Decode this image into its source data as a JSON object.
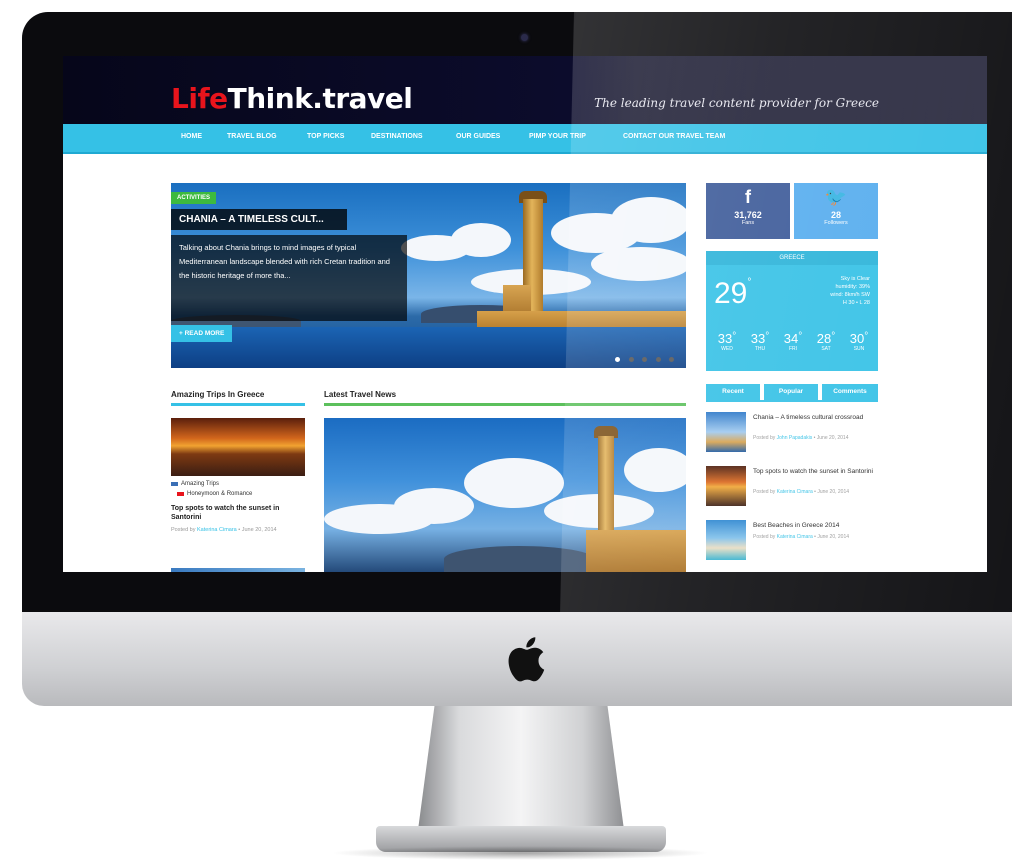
{
  "site": {
    "logo_red": "Life",
    "logo_white": "Think.travel",
    "tagline": "The leading travel content provider for Greece"
  },
  "nav": {
    "items": [
      {
        "label": "Home"
      },
      {
        "label": "Travel Blog"
      },
      {
        "label": "Top Picks"
      },
      {
        "label": "Destinations"
      },
      {
        "label": "Our Guides"
      },
      {
        "label": "Pimp Your Trip"
      },
      {
        "label": "Contact Our Travel Team"
      }
    ]
  },
  "hero": {
    "badge": "Activities",
    "title": "CHANIA – A TIMELESS CULT...",
    "description": "Talking about Chania brings to mind images of typical Mediterranean landscape blended with rich Cretan tradition and the historic heritage of more tha...",
    "read_more": "Read More",
    "slides": 5,
    "active_slide": 1
  },
  "social": {
    "facebook": {
      "icon": "f",
      "count": "31,762",
      "label": "Fans",
      "color": "#3b5998"
    },
    "twitter": {
      "icon": "🐦",
      "count": "28",
      "label": "Followers",
      "color": "#55acee"
    }
  },
  "weather": {
    "location": "Greece",
    "temp": "29",
    "unit": "°",
    "details": [
      "Sky is Clear",
      "humidity: 39%",
      "wind: 8km/h SW",
      "H 30 • L 28"
    ],
    "forecast": [
      {
        "temp": "33",
        "day": "Wed"
      },
      {
        "temp": "33",
        "day": "Thu"
      },
      {
        "temp": "34",
        "day": "Fri"
      },
      {
        "temp": "28",
        "day": "Sat"
      },
      {
        "temp": "30",
        "day": "Sun"
      }
    ]
  },
  "amazing_trips": {
    "heading": "Amazing Trips In Greece",
    "cat1": "Amazing Trips",
    "cat2": "Honeymoon & Romance",
    "post_title": "Top spots to watch the sunset in Santorini",
    "post_meta_prefix": "Posted by",
    "post_author": "Katerina Cimara",
    "post_date": "June 20, 2014"
  },
  "latest_news": {
    "heading": "Latest Travel News"
  },
  "tabs": {
    "recent": "Recent",
    "popular": "Popular",
    "comments": "Comments"
  },
  "sidebar_posts": [
    {
      "title": "Chania – A timeless cultural crossroad",
      "prefix": "Posted by",
      "author": "John Papadakis",
      "date": "June 20, 2014"
    },
    {
      "title": "Top spots to watch the sunset in Santorini",
      "prefix": "Posted by",
      "author": "Katerina Cimara",
      "date": "June 20, 2014"
    },
    {
      "title": "Best Beaches in Greece 2014",
      "prefix": "Posted by",
      "author": "Katerina Cimara",
      "date": "June 20, 2014"
    }
  ],
  "colors": {
    "accent": "#35c1e6",
    "logo_red": "#e8141c",
    "header_bg": "#06061a",
    "badge_green": "#3dba3f"
  }
}
